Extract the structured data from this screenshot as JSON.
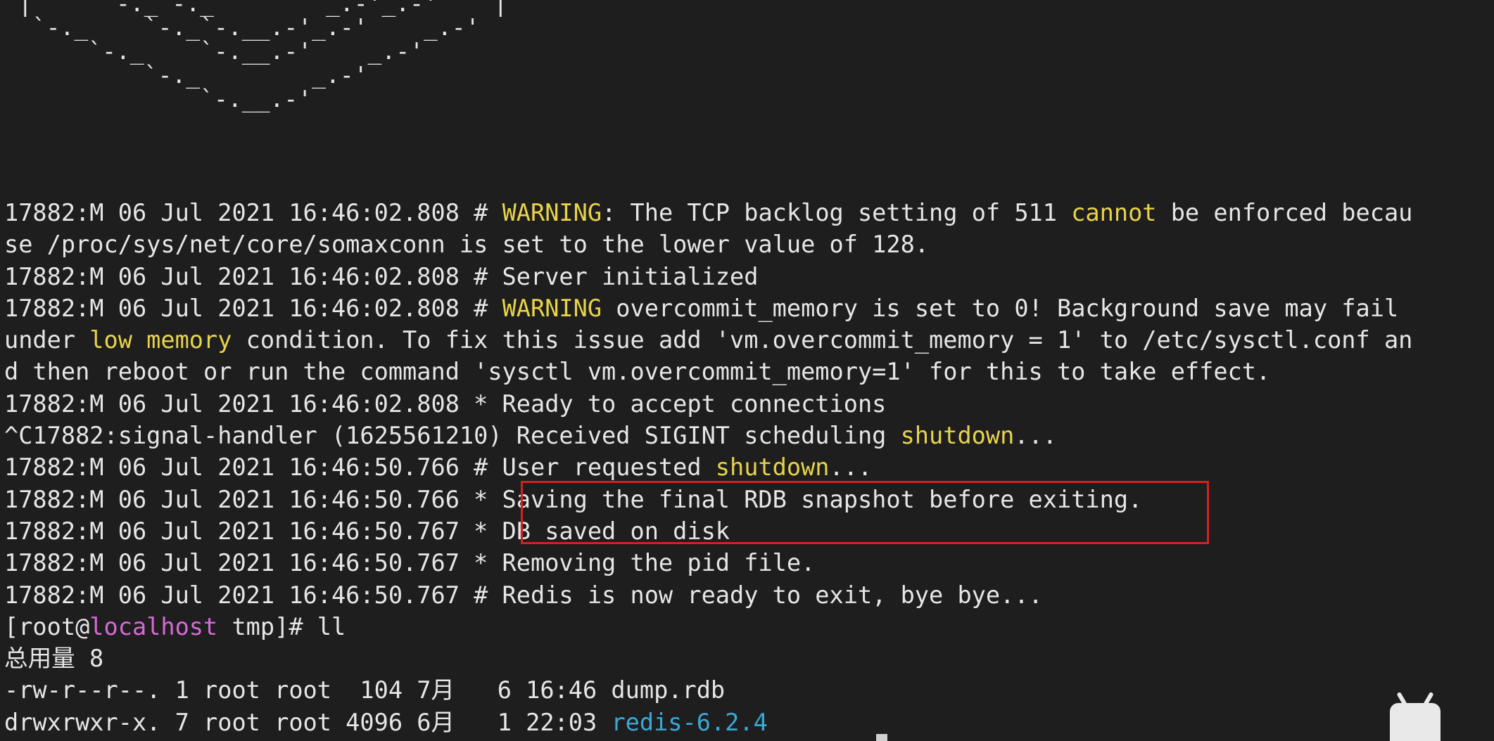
{
  "terminal": {
    "ascii_logo": [
      " |     `-._`-._        _.-'_.-'    |",
      "  `-._    `-._`-.__.-'_.-'    _.-'",
      "      `-._    `-.__.-'    _.-'",
      "          `-._        _.-'",
      "              `-.__.-'"
    ],
    "lines": [
      {
        "pre": "17882:M 06 Jul 2021 16:46:02.808 # ",
        "hl1": "WARNING",
        "mid1": ": The TCP backlog setting of 511 ",
        "hl2": "cannot",
        "post": " be enforced becau"
      },
      {
        "pre": "se /proc/sys/net/core/somaxconn is set to the lower value of 128."
      },
      {
        "pre": "17882:M 06 Jul 2021 16:46:02.808 # Server initialized"
      },
      {
        "pre": "17882:M 06 Jul 2021 16:46:02.808 # ",
        "hl1": "WARNING",
        "post": " overcommit_memory is set to 0! Background save may fail"
      },
      {
        "pre": "under ",
        "hl1": "low memory",
        "post": " condition. To fix this issue add 'vm.overcommit_memory = 1' to /etc/sysctl.conf an"
      },
      {
        "pre": "d then reboot or run the command 'sysctl vm.overcommit_memory=1' for this to take effect."
      },
      {
        "pre": "17882:M 06 Jul 2021 16:46:02.808 * Ready to accept connections"
      },
      {
        "pre": "^C17882:signal-handler (1625561210) Received SIGINT scheduling ",
        "hl1": "shutdown",
        "post": "..."
      },
      {
        "pre": "17882:M 06 Jul 2021 16:46:50.766 # User requested ",
        "hl1": "shutdown",
        "post": "..."
      },
      {
        "pre": "17882:M 06 Jul 2021 16:46:50.766 * Saving the final RDB snapshot before exiting."
      },
      {
        "pre": "17882:M 06 Jul 2021 16:46:50.767 * DB saved on disk"
      },
      {
        "pre": "17882:M 06 Jul 2021 16:46:50.767 * Removing the pid file."
      },
      {
        "pre": "17882:M 06 Jul 2021 16:46:50.767 # Redis is now ready to exit, bye bye..."
      },
      {
        "pre": "[root@",
        "host": "localhost",
        "post": " tmp]# ll"
      },
      {
        "pre": "总用量 8"
      },
      {
        "pre": "-rw-r--r--. 1 root root  104 7月   6 16:46 dump.rdb"
      },
      {
        "pre": "drwxrwxr-x. 7 root root 4096 6月   1 22:03 ",
        "dir": "redis-6.2.4"
      }
    ]
  },
  "colors": {
    "background": "#1e1e1e",
    "text": "#e6e6e6",
    "warning_yellow": "#e8d34a",
    "hostname_magenta": "#d66ad6",
    "directory_blue": "#3aa8d8",
    "highlight_box_red": "#d32020"
  }
}
